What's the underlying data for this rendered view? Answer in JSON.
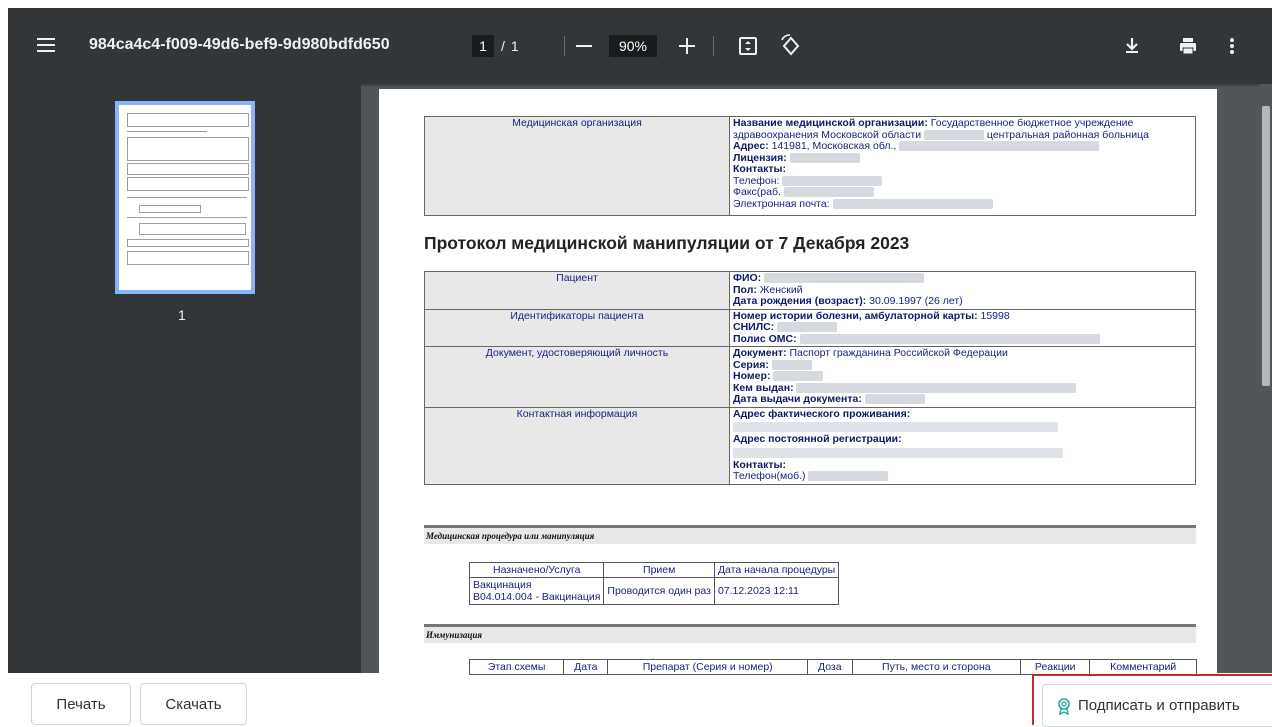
{
  "toolbar": {
    "title": "984ca4c4-f009-49d6-bef9-9d980bdfd650",
    "page_current": "1",
    "page_sep": "/",
    "page_total": "1",
    "zoom": "90%",
    "icons": [
      "menu-icon",
      "zoom-out-icon",
      "zoom-in-icon",
      "fit-page-icon",
      "rotate-icon",
      "download-icon",
      "print-icon",
      "more-icon"
    ]
  },
  "sidebar": {
    "thumb_label": "1"
  },
  "doc": {
    "org": {
      "label": "Медицинская организация",
      "name_key": "Название медицинской организации:",
      "name_val_1": "Государственное бюджетное учреждение",
      "name_val_2": "здравоохранения Московской области",
      "name_val_3": "центральная районная больница",
      "addr_key": "Адрес:",
      "addr_val": "141981, Московская обл.,",
      "lic_key": "Лицензия:",
      "contacts_key": "Контакты:",
      "phone": "Телефон:",
      "fax": "Факс(раб.",
      "email": "Электронная почта:"
    },
    "title": "Протокол медицинской манипуляции от 7 Декабря 2023",
    "patient": {
      "label": "Пациент",
      "fio_key": "ФИО:",
      "sex_key": "Пол:",
      "sex_val": "Женский",
      "dob_key": "Дата рождения (возраст):",
      "dob_val": "30.09.1997 (26 лет)"
    },
    "ids": {
      "label": "Идентификаторы пациента",
      "hist_key": "Номер истории болезни, амбулаторной карты:",
      "hist_val": "15998",
      "snils_key": "СНИЛС:",
      "oms_key": "Полис ОМС:"
    },
    "docid": {
      "label": "Документ, удостоверяющий личность",
      "doc_key": "Документ:",
      "doc_val": "Паспорт гражданина Российской Федерации",
      "series_key": "Серия:",
      "num_key": "Номер:",
      "issued_key": "Кем выдан:",
      "date_key": "Дата выдачи документа:"
    },
    "contact": {
      "label": "Контактная информация",
      "fact_key": "Адрес фактического проживания:",
      "reg_key": "Адрес постоянной регистрации:",
      "contacts_key": "Контакты:",
      "mobile": "Телефон(моб.)"
    },
    "proc": {
      "header": "Медицинская процедура или манипуляция",
      "cols": [
        "Назначено/Услуга",
        "Прием",
        "Дата начала процедуры"
      ],
      "row": [
        "Вакцинация",
        "B04.014.004 - Вакцинация",
        "Проводится один раз",
        "07.12.2023 12:11"
      ]
    },
    "immun": {
      "header": "Иммунизация",
      "cols": [
        "Этап схемы",
        "Дата",
        "Препарат (Серия и номер)",
        "Доза",
        "Путь, место и сторона",
        "Реакции",
        "Комментарий"
      ]
    }
  },
  "footer": {
    "print": "Печать",
    "download": "Скачать",
    "sign": "Подписать и отправить"
  }
}
